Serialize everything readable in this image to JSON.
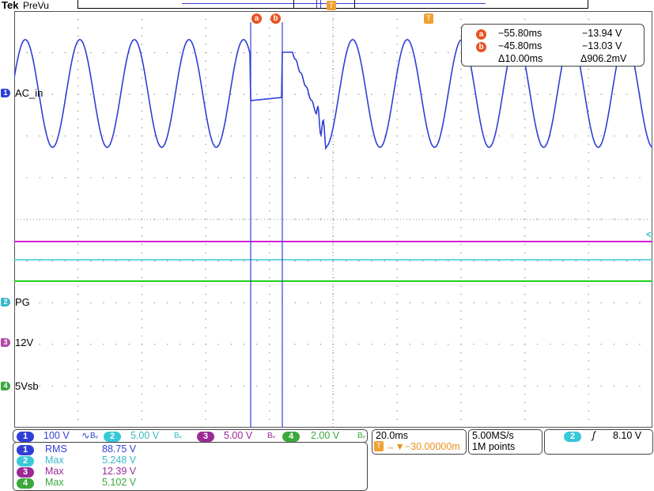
{
  "header": {
    "brand": "Tek",
    "mode": "PreVu"
  },
  "trigger_marker_label": "T",
  "channels_left": [
    {
      "num": "1",
      "label": "AC_in",
      "color": "#2f3fd6"
    },
    {
      "num": "2",
      "label": "PG",
      "color": "#38b8c8"
    },
    {
      "num": "3",
      "label": "12V",
      "color": "#b04aa8"
    },
    {
      "num": "4",
      "label": "5Vsb",
      "color": "#3ba83b"
    }
  ],
  "cursors": {
    "a": {
      "badge": "a",
      "time": "−55.80ms",
      "volt": "−13.94 V"
    },
    "b": {
      "badge": "b",
      "time": "−45.80ms",
      "volt": "−13.03 V"
    },
    "delta_time": "Δ10.00ms",
    "delta_volt": "Δ906.2mV"
  },
  "scale_bar": {
    "ch1": {
      "num": "1",
      "value": "100 V",
      "coupling": "∿",
      "bw": "Bᵥ"
    },
    "ch2": {
      "num": "2",
      "value": "5.00 V",
      "bw": "Bᵥ"
    },
    "ch3": {
      "num": "3",
      "value": "5.00 V",
      "bw": "Bᵥ"
    },
    "ch4": {
      "num": "4",
      "value": "2.00 V",
      "bw": "Bᵥ"
    }
  },
  "timebase": {
    "time_div": "20.0ms",
    "position": "→▼−30.00000m"
  },
  "acquisition": {
    "rate": "5.00MS/s",
    "points": "1M points"
  },
  "trigger": {
    "source": "2",
    "slope": "ʃ",
    "level": "8.10 V"
  },
  "measurements": [
    {
      "num": "1",
      "name": "RMS",
      "value": "88.75 V",
      "color": "#2f3fd6"
    },
    {
      "num": "2",
      "name": "Max",
      "value": "5.248 V",
      "color": "#38b8c8"
    },
    {
      "num": "3",
      "name": "Max",
      "value": "12.39 V",
      "color": "#9a2a96"
    },
    {
      "num": "4",
      "name": "Max",
      "value": "5.102 V",
      "color": "#3ba83b"
    }
  ],
  "colors": {
    "ch1": "#2f3fd6",
    "ch2": "#38c8d8",
    "ch3": "#d020d0",
    "ch4": "#20d020",
    "cursor": "#e8531f",
    "trigger": "#f0a030"
  }
}
